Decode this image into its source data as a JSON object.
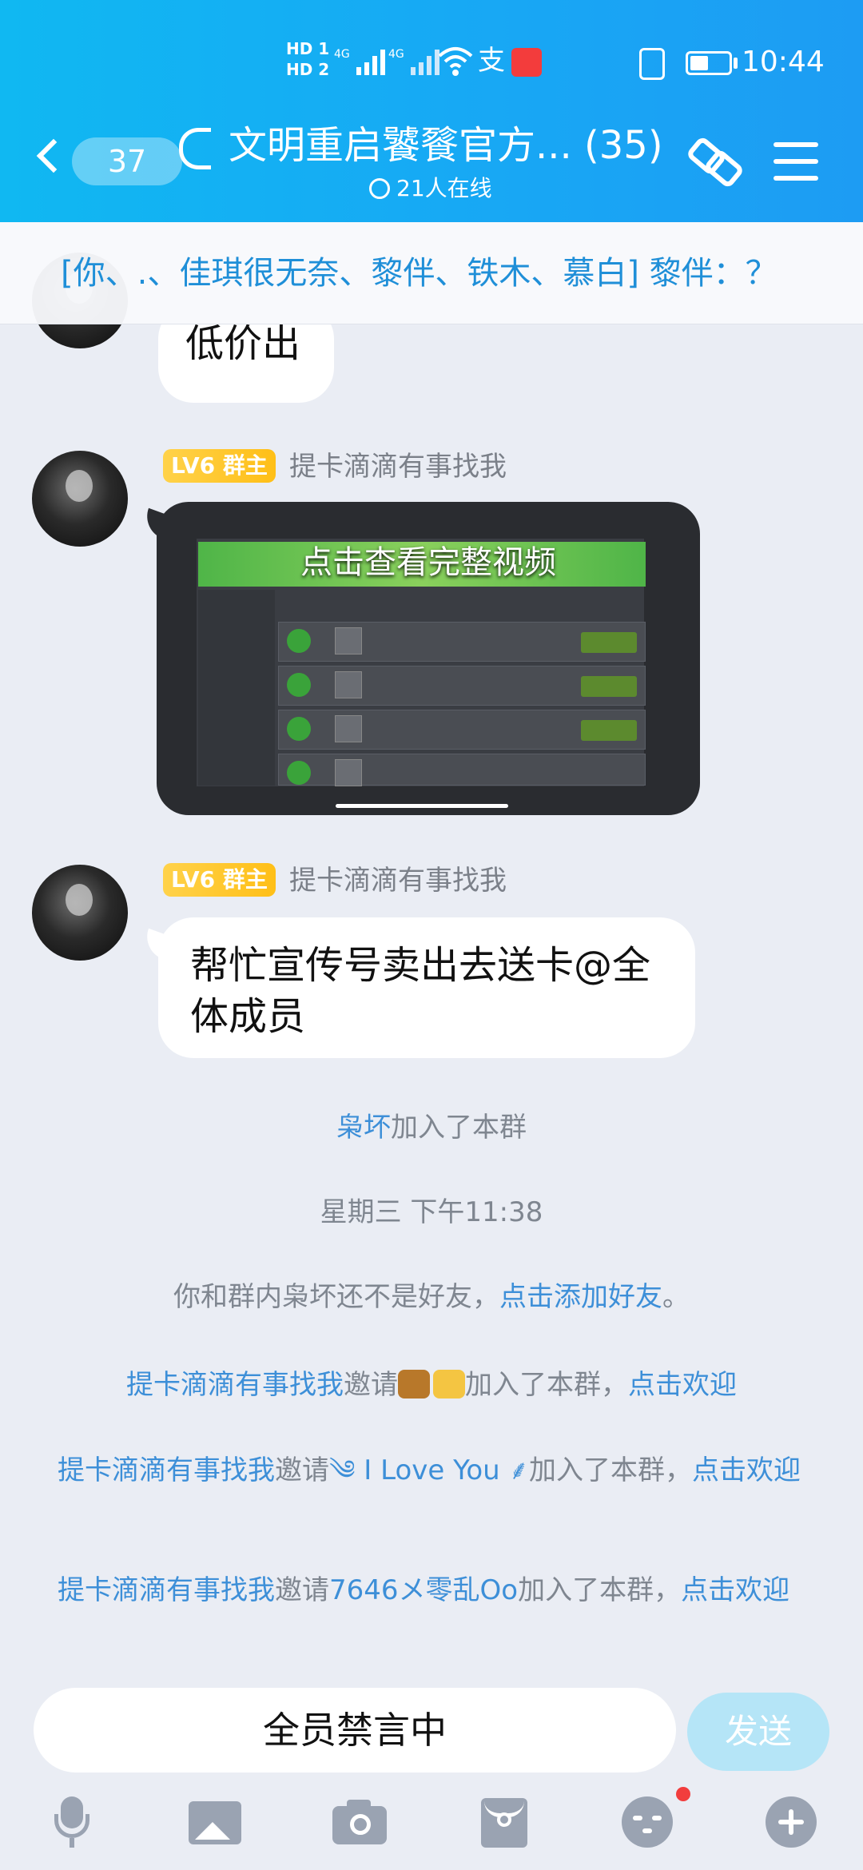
{
  "status_bar": {
    "net1": "HD 1",
    "net2": "HD 2",
    "sig1": "4G",
    "sig2": "4G",
    "time": "10:44"
  },
  "header": {
    "back_count": "37",
    "title": "文明重启饕餮官方... (35)",
    "online": "21人在线"
  },
  "notice": {
    "text": "[你、.、佳琪很无奈、黎伴、铁木、慕白] 黎伴：？"
  },
  "messages": [
    {
      "text": "低价出"
    },
    {
      "badge": "LV6 群主",
      "sender": "提卡滴滴有事找我",
      "video_caption": "点击查看完整视频"
    },
    {
      "badge": "LV6 群主",
      "sender": "提卡滴滴有事找我",
      "text": "帮忙宣传号卖出去送卡@全体成员"
    }
  ],
  "system": {
    "join_name": "枭坏",
    "join_suffix": "加入了本群",
    "timestamp": "星期三 下午11:38",
    "friend_prefix": "你和群内枭坏还不是好友，",
    "friend_link": "点击添加好友",
    "friend_suffix": "。",
    "invite1_inviter": "提卡滴滴有事找我",
    "invite1_mid": "邀请",
    "invite1_suffix": "加入了本群，",
    "invite1_link": "点击欢迎",
    "invite2_inviter": "提卡滴滴有事找我",
    "invite2_mid": "邀请",
    "invite2_name": "༄ I Love You ⸙",
    "invite2_suffix": "加入了本群，",
    "invite2_link": "点击欢迎",
    "invite3_inviter": "提卡滴滴有事找我",
    "invite3_mid": "邀请",
    "invite3_name": "7646メ零乱Oo",
    "invite3_suffix": "加入了本群，",
    "invite3_link": "点击欢迎"
  },
  "input": {
    "placeholder": "全员禁言中",
    "send": "发送"
  },
  "toolbar": {
    "icons": [
      "microphone-icon",
      "picture-icon",
      "camera-icon",
      "red-packet-icon",
      "emoji-icon",
      "plus-icon"
    ]
  }
}
